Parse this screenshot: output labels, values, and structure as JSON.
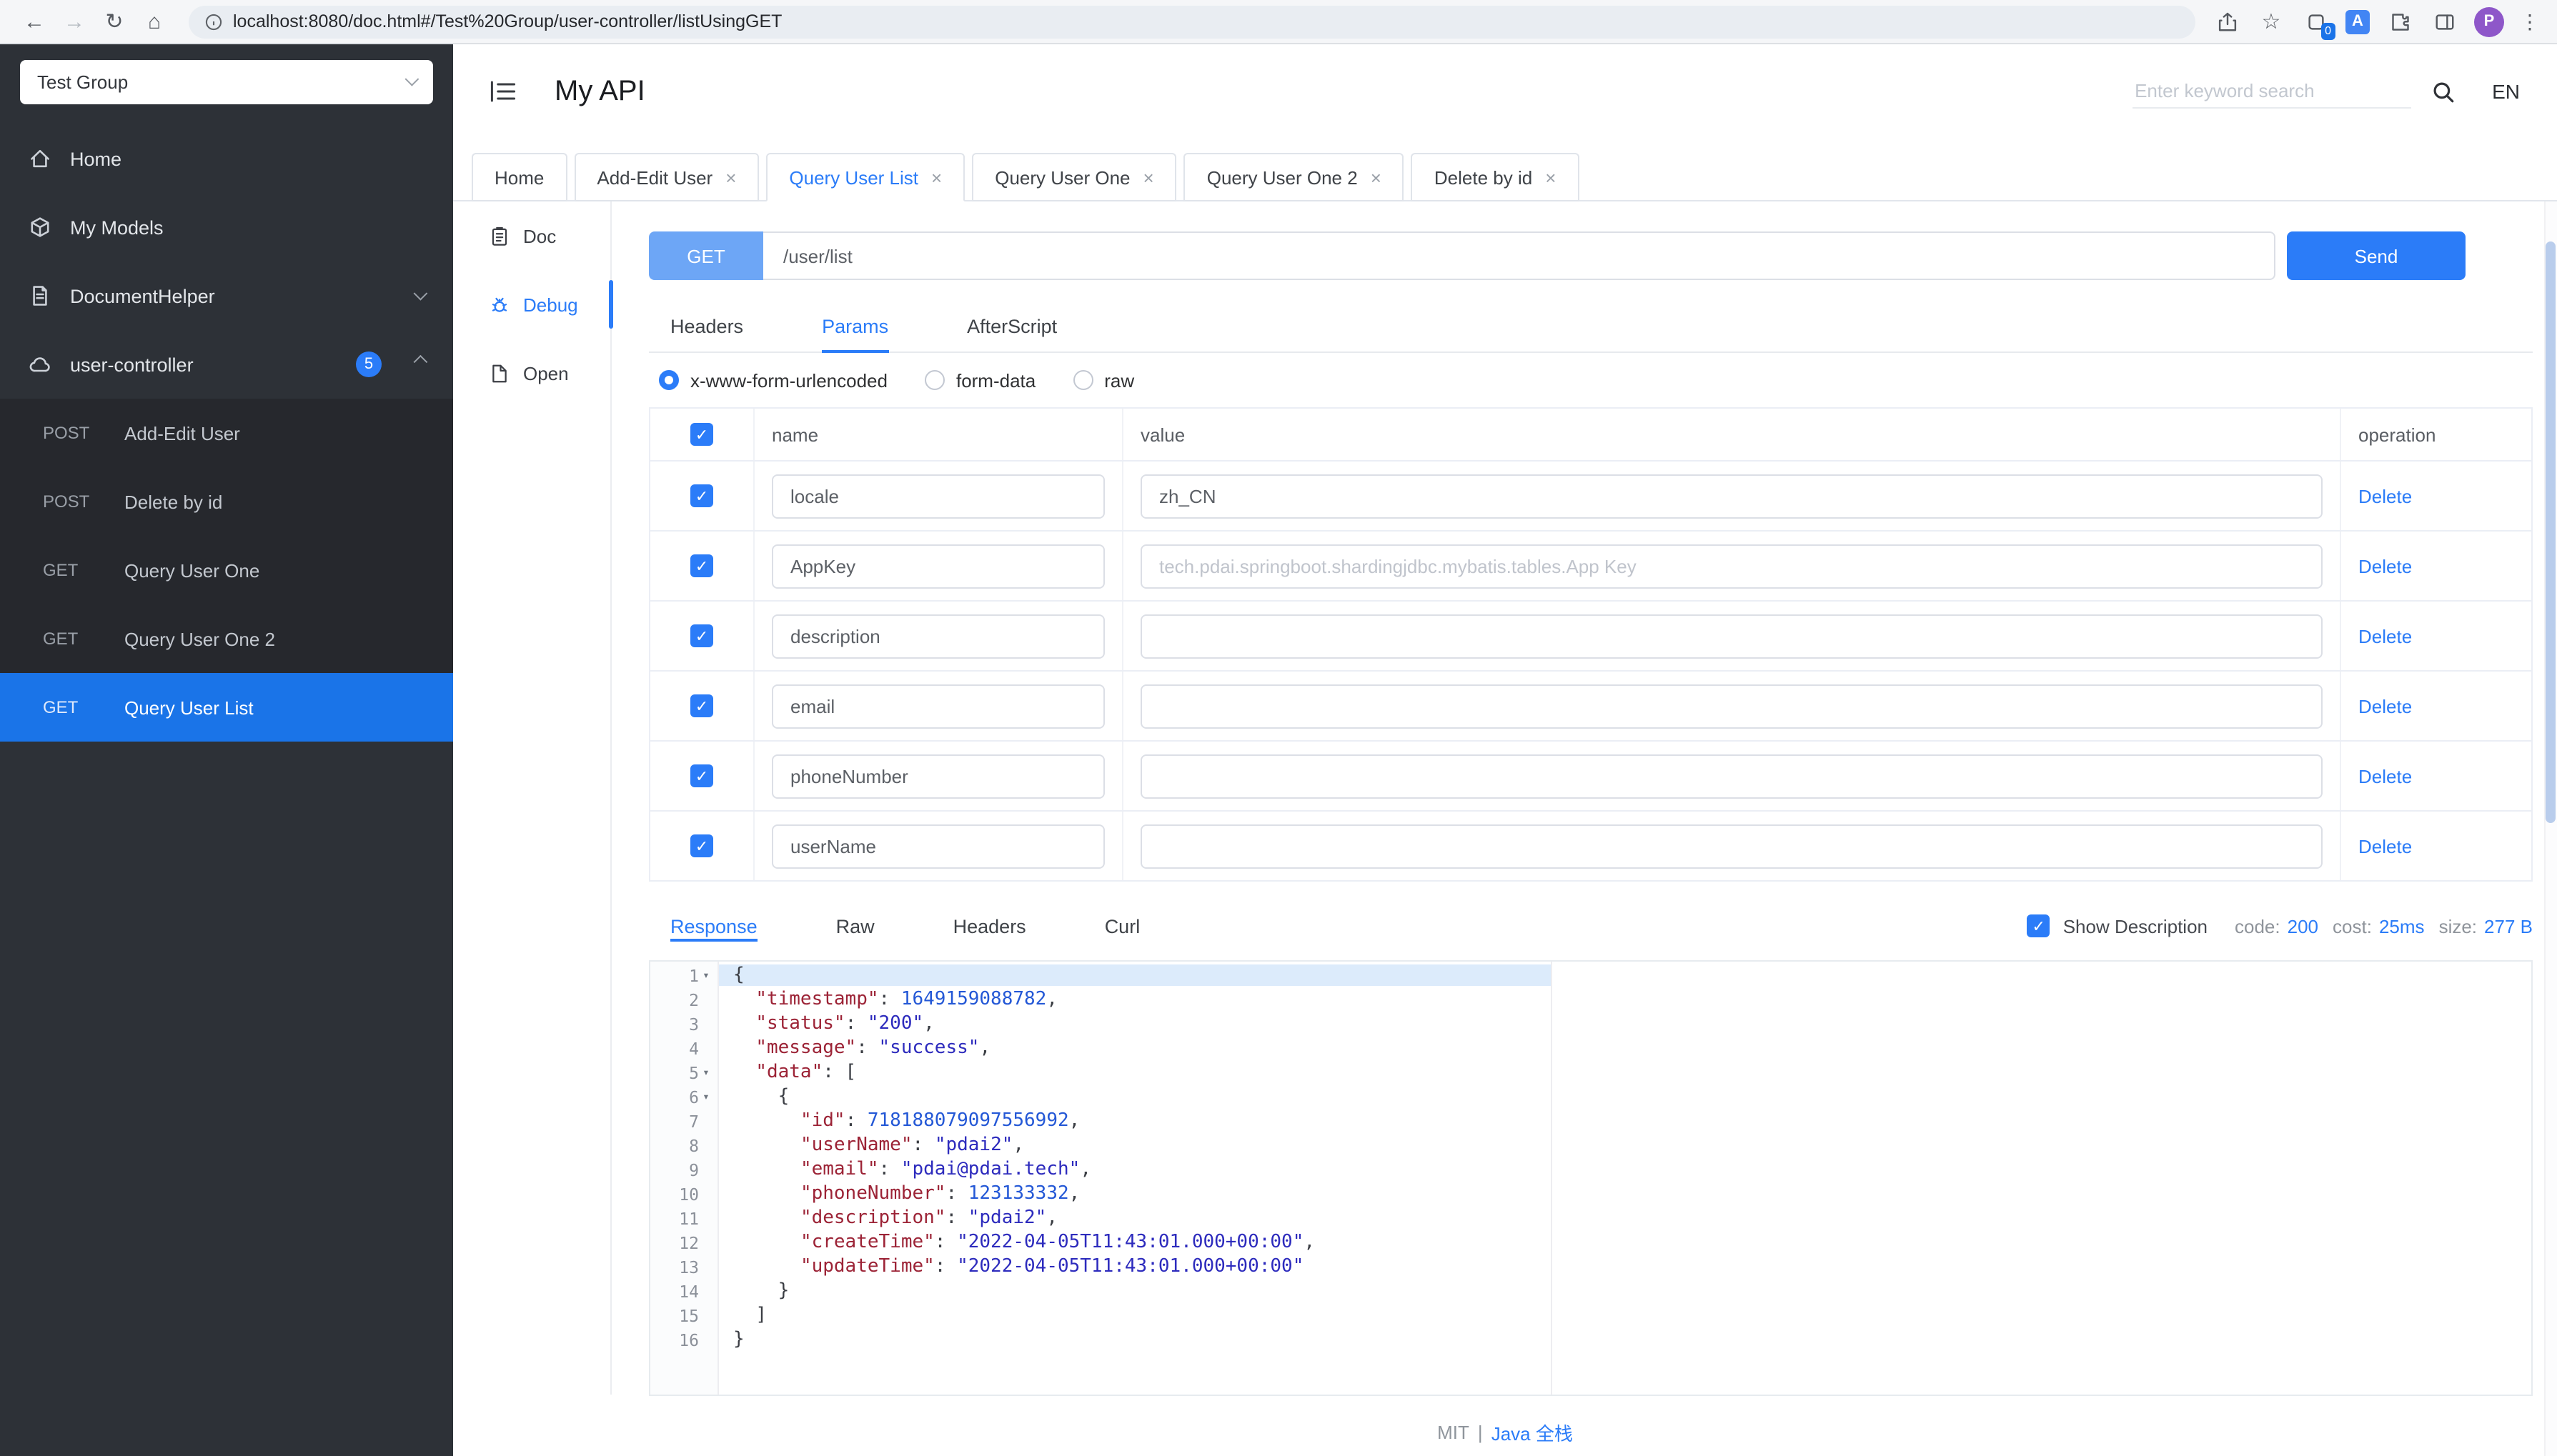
{
  "colors": {
    "primary": "#2b7cf8",
    "sidebar-active": "#1a74e8",
    "method-get-bg": "#6da6f6"
  },
  "browser": {
    "url": "localhost:8080/doc.html#/Test%20Group/user-controller/listUsingGET",
    "profile_initial": "P",
    "extension_badge_count": "0"
  },
  "sidebar": {
    "group_selector": "Test Group",
    "items": [
      {
        "label": "Home",
        "icon": "home-icon"
      },
      {
        "label": "My Models",
        "icon": "models-icon"
      },
      {
        "label": "DocumentHelper",
        "icon": "document-helper-icon",
        "chevron": "down"
      },
      {
        "label": "user-controller",
        "icon": "controller-icon",
        "badge": "5",
        "chevron": "up"
      }
    ],
    "sub_items": [
      {
        "method": "POST",
        "label": "Add-Edit User",
        "active": false
      },
      {
        "method": "POST",
        "label": "Delete by id",
        "active": false
      },
      {
        "method": "GET",
        "label": "Query User One",
        "active": false
      },
      {
        "method": "GET",
        "label": "Query User One 2",
        "active": false
      },
      {
        "method": "GET",
        "label": "Query User List",
        "active": true
      }
    ]
  },
  "header": {
    "title": "My API",
    "search_placeholder": "Enter keyword search",
    "lang": "EN"
  },
  "tabs": [
    {
      "label": "Home",
      "closable": false,
      "active": false
    },
    {
      "label": "Add-Edit User",
      "closable": true,
      "active": false
    },
    {
      "label": "Query User List",
      "closable": true,
      "active": true
    },
    {
      "label": "Query User One",
      "closable": true,
      "active": false
    },
    {
      "label": "Query User One 2",
      "closable": true,
      "active": false
    },
    {
      "label": "Delete by id",
      "closable": true,
      "active": false
    }
  ],
  "side_nav": [
    {
      "label": "Doc",
      "icon": "doc-icon",
      "active": false
    },
    {
      "label": "Debug",
      "icon": "debug-icon",
      "active": true
    },
    {
      "label": "Open",
      "icon": "open-icon",
      "active": false
    }
  ],
  "request": {
    "method": "GET",
    "url": "/user/list",
    "send_label": "Send"
  },
  "request_tabs": [
    {
      "label": "Headers",
      "active": false
    },
    {
      "label": "Params",
      "active": true
    },
    {
      "label": "AfterScript",
      "active": false
    }
  ],
  "body_types": [
    {
      "label": "x-www-form-urlencoded",
      "selected": true
    },
    {
      "label": "form-data",
      "selected": false
    },
    {
      "label": "raw",
      "selected": false
    }
  ],
  "params_table": {
    "columns": [
      "name",
      "value",
      "operation"
    ],
    "rows": [
      {
        "checked": true,
        "name": "locale",
        "value": "zh_CN",
        "placeholder": "",
        "action": "Delete"
      },
      {
        "checked": true,
        "name": "AppKey",
        "value": "",
        "placeholder": "tech.pdai.springboot.shardingjdbc.mybatis.tables.App Key",
        "action": "Delete"
      },
      {
        "checked": true,
        "name": "description",
        "value": "",
        "placeholder": "",
        "action": "Delete"
      },
      {
        "checked": true,
        "name": "email",
        "value": "",
        "placeholder": "",
        "action": "Delete"
      },
      {
        "checked": true,
        "name": "phoneNumber",
        "value": "",
        "placeholder": "",
        "action": "Delete"
      },
      {
        "checked": true,
        "name": "userName",
        "value": "",
        "placeholder": "",
        "action": "Delete"
      }
    ]
  },
  "response": {
    "tabs": [
      {
        "label": "Response",
        "active": true
      },
      {
        "label": "Raw",
        "active": false
      },
      {
        "label": "Headers",
        "active": false
      },
      {
        "label": "Curl",
        "active": false
      }
    ],
    "show_description": {
      "label": "Show Description",
      "checked": true
    },
    "stats": [
      {
        "label": "code:",
        "value": "200"
      },
      {
        "label": "cost:",
        "value": "25ms"
      },
      {
        "label": "size:",
        "value": "277 B"
      }
    ]
  },
  "response_json": {
    "lines": [
      {
        "num": 1,
        "caret": true,
        "highlight": true,
        "tokens": [
          [
            "p",
            "{"
          ]
        ]
      },
      {
        "num": 2,
        "tokens": [
          [
            "w",
            "  "
          ],
          [
            "k",
            "\"timestamp\""
          ],
          [
            "p",
            ": "
          ],
          [
            "n",
            "1649159088782"
          ],
          [
            "p",
            ","
          ]
        ]
      },
      {
        "num": 3,
        "tokens": [
          [
            "w",
            "  "
          ],
          [
            "k",
            "\"status\""
          ],
          [
            "p",
            ": "
          ],
          [
            "s",
            "\"200\""
          ],
          [
            "p",
            ","
          ]
        ]
      },
      {
        "num": 4,
        "tokens": [
          [
            "w",
            "  "
          ],
          [
            "k",
            "\"message\""
          ],
          [
            "p",
            ": "
          ],
          [
            "s",
            "\"success\""
          ],
          [
            "p",
            ","
          ]
        ]
      },
      {
        "num": 5,
        "caret": true,
        "tokens": [
          [
            "w",
            "  "
          ],
          [
            "k",
            "\"data\""
          ],
          [
            "p",
            ": ["
          ]
        ]
      },
      {
        "num": 6,
        "caret": true,
        "tokens": [
          [
            "w",
            "    "
          ],
          [
            "p",
            "{"
          ]
        ]
      },
      {
        "num": 7,
        "tokens": [
          [
            "w",
            "      "
          ],
          [
            "k",
            "\"id\""
          ],
          [
            "p",
            ": "
          ],
          [
            "n",
            "718188079097556992"
          ],
          [
            "p",
            ","
          ]
        ]
      },
      {
        "num": 8,
        "tokens": [
          [
            "w",
            "      "
          ],
          [
            "k",
            "\"userName\""
          ],
          [
            "p",
            ": "
          ],
          [
            "s",
            "\"pdai2\""
          ],
          [
            "p",
            ","
          ]
        ]
      },
      {
        "num": 9,
        "tokens": [
          [
            "w",
            "      "
          ],
          [
            "k",
            "\"email\""
          ],
          [
            "p",
            ": "
          ],
          [
            "s",
            "\"pdai@pdai.tech\""
          ],
          [
            "p",
            ","
          ]
        ]
      },
      {
        "num": 10,
        "tokens": [
          [
            "w",
            "      "
          ],
          [
            "k",
            "\"phoneNumber\""
          ],
          [
            "p",
            ": "
          ],
          [
            "n",
            "123133332"
          ],
          [
            "p",
            ","
          ]
        ]
      },
      {
        "num": 11,
        "tokens": [
          [
            "w",
            "      "
          ],
          [
            "k",
            "\"description\""
          ],
          [
            "p",
            ": "
          ],
          [
            "s",
            "\"pdai2\""
          ],
          [
            "p",
            ","
          ]
        ]
      },
      {
        "num": 12,
        "tokens": [
          [
            "w",
            "      "
          ],
          [
            "k",
            "\"createTime\""
          ],
          [
            "p",
            ": "
          ],
          [
            "s",
            "\"2022-04-05T11:43:01.000+00:00\""
          ],
          [
            "p",
            ","
          ]
        ]
      },
      {
        "num": 13,
        "tokens": [
          [
            "w",
            "      "
          ],
          [
            "k",
            "\"updateTime\""
          ],
          [
            "p",
            ": "
          ],
          [
            "s",
            "\"2022-04-05T11:43:01.000+00:00\""
          ]
        ]
      },
      {
        "num": 14,
        "tokens": [
          [
            "w",
            "    "
          ],
          [
            "p",
            "}"
          ]
        ]
      },
      {
        "num": 15,
        "tokens": [
          [
            "w",
            "  "
          ],
          [
            "p",
            "]"
          ]
        ]
      },
      {
        "num": 16,
        "tokens": [
          [
            "p",
            "}"
          ]
        ]
      }
    ]
  },
  "footer": {
    "license": "MIT",
    "separator": "|",
    "link": "Java 全栈"
  }
}
